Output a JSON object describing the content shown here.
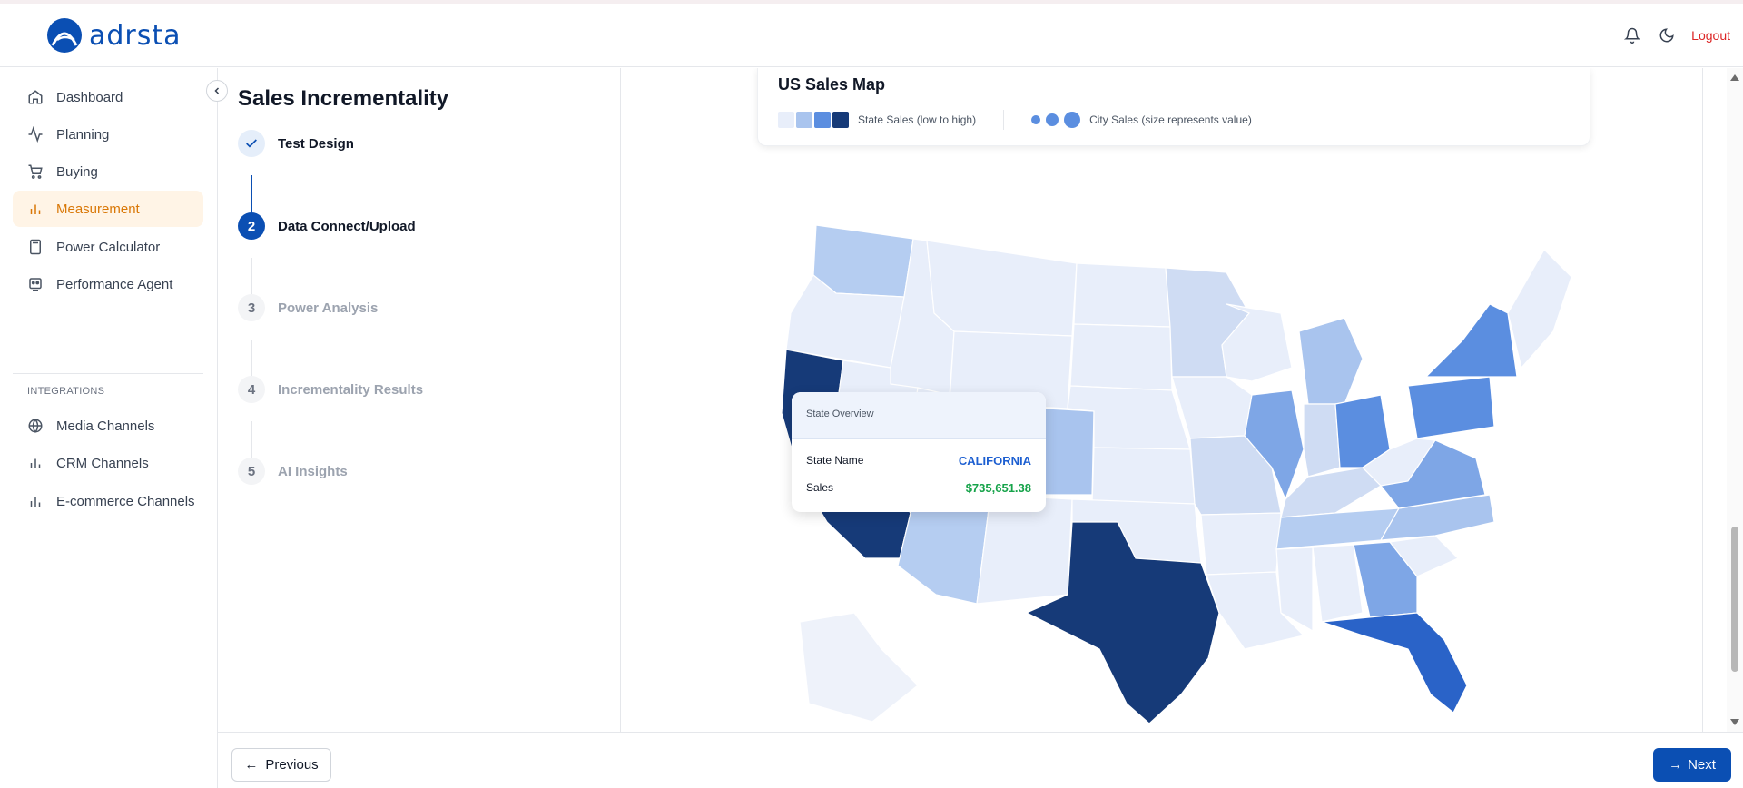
{
  "app": {
    "logo_text": "adrsta",
    "logout_label": "Logout"
  },
  "icons": {
    "notifications": "bell-icon",
    "theme": "moon-icon",
    "collapse": "chevron-left-icon"
  },
  "sidebar": {
    "items": [
      {
        "label": "Dashboard",
        "icon": "home-icon",
        "active": false
      },
      {
        "label": "Planning",
        "icon": "activity-icon",
        "active": false
      },
      {
        "label": "Buying",
        "icon": "cart-icon",
        "active": false
      },
      {
        "label": "Measurement",
        "icon": "bar-chart-icon",
        "active": true
      },
      {
        "label": "Power Calculator",
        "icon": "calculator-icon",
        "active": false
      },
      {
        "label": "Performance Agent",
        "icon": "bot-icon",
        "active": false
      }
    ],
    "section_label": "INTEGRATIONS",
    "integrations": [
      {
        "label": "Media Channels",
        "icon": "globe-icon"
      },
      {
        "label": "CRM Channels",
        "icon": "bar-chart-icon"
      },
      {
        "label": "E-commerce Channels",
        "icon": "bar-chart-icon"
      }
    ]
  },
  "stepper": {
    "title": "Sales Incrementality",
    "steps": [
      {
        "number": "",
        "label": "Test Design",
        "state": "done"
      },
      {
        "number": "2",
        "label": "Data Connect/Upload",
        "state": "active"
      },
      {
        "number": "3",
        "label": "Power Analysis",
        "state": "pending"
      },
      {
        "number": "4",
        "label": "Incrementality Results",
        "state": "pending"
      },
      {
        "number": "5",
        "label": "AI Insights",
        "state": "pending"
      }
    ]
  },
  "map": {
    "title": "US Sales Map",
    "legend_state": "State Sales (low to high)",
    "legend_city": "City Sales (size represents value)",
    "scale_colors": [
      "#e8eefa",
      "#a9c4ee",
      "#5b8ee0",
      "#2a63c8",
      "#163a78"
    ],
    "tooltip": {
      "heading": "State Overview",
      "name_label": "State Name",
      "name_value": "CALIFORNIA",
      "sales_label": "Sales",
      "sales_value": "$735,651.38"
    }
  },
  "footer": {
    "previous_label": "Previous",
    "next_label": "Next"
  }
}
